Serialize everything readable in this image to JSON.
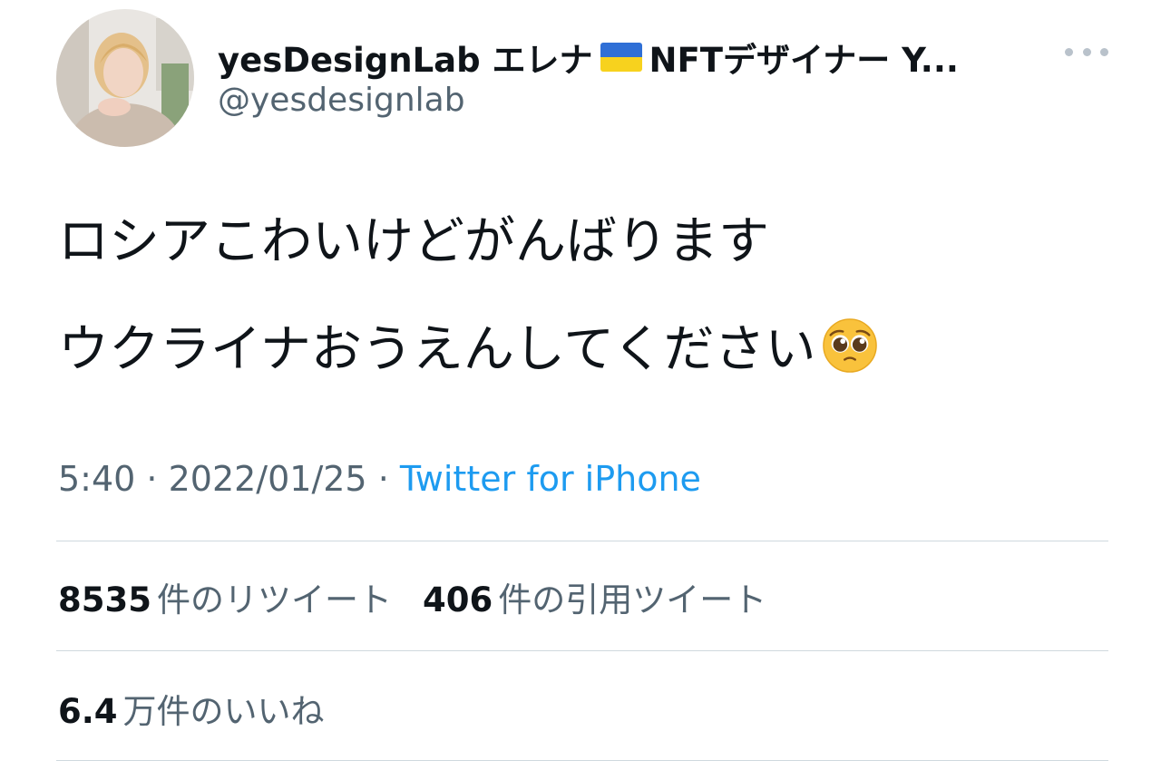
{
  "author": {
    "display_name_prefix": "yesDesignLab エレナ",
    "display_name_suffix": "NFTデザイナー Y...",
    "flag_icon": "ukraine-flag-icon",
    "flag_colors": {
      "top": "#2f6fd6",
      "bottom": "#f7d21e"
    },
    "handle": "@yesdesignlab",
    "avatar_icon": "profile-avatar"
  },
  "more_icon": "more-options-icon",
  "tweet": {
    "line1": "ロシアこわいけどがんばります",
    "line2": "ウクライナおうえんしてください",
    "emoji_icon": "pleading-face-icon"
  },
  "meta": {
    "time": "5:40",
    "sep1": " · ",
    "date": "2022/01/25",
    "sep2": " · ",
    "source": "Twitter for iPhone"
  },
  "stats": {
    "retweets": {
      "value": "8535",
      "label": "件のリツイート"
    },
    "quotes": {
      "value": "406",
      "label": "件の引用ツイート"
    },
    "likes": {
      "value": "6.4",
      "label": "万件のいいね"
    }
  },
  "colors": {
    "text_primary": "#0f1419",
    "text_secondary": "#536471",
    "link": "#1d9bf0",
    "divider": "#cfd9de"
  }
}
